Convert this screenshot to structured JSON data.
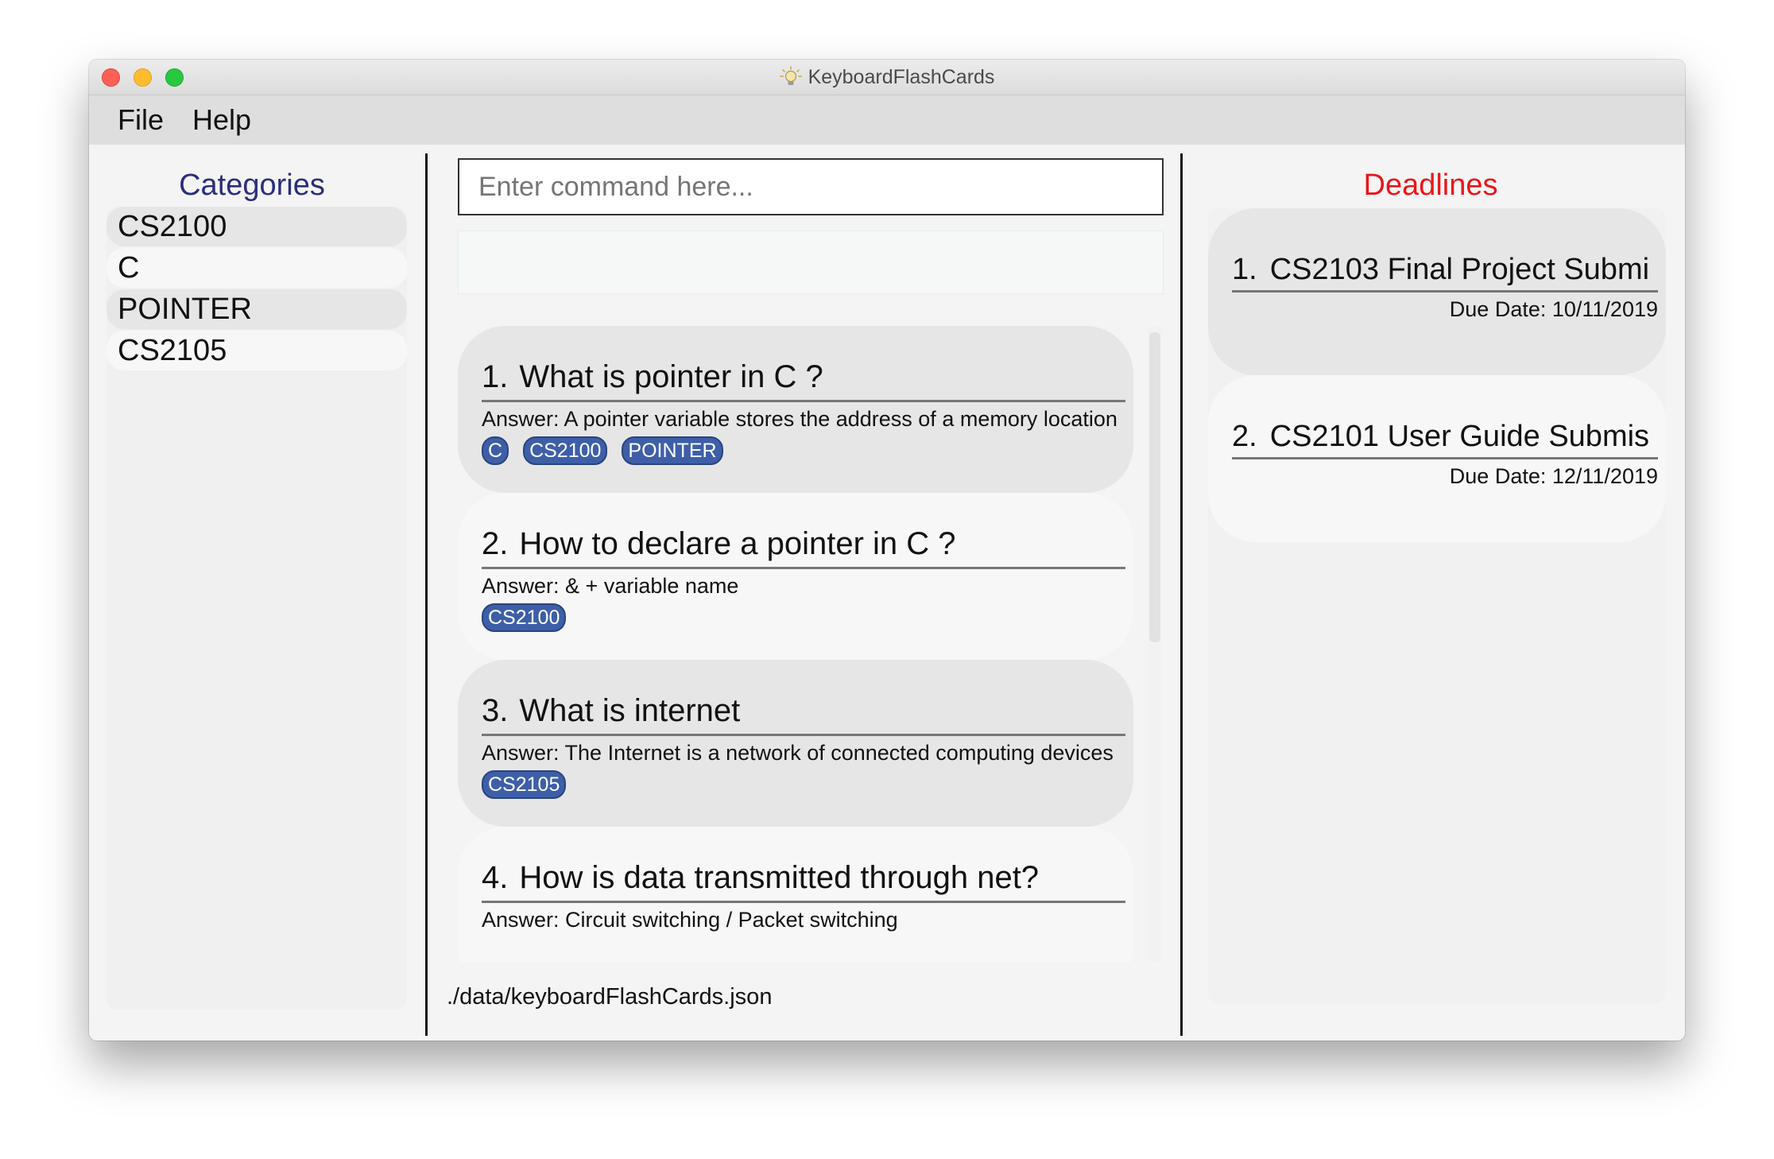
{
  "window": {
    "title": "KeyboardFlashCards"
  },
  "menu": {
    "items": [
      "File",
      "Help"
    ]
  },
  "categories": {
    "title": "Categories",
    "items": [
      "CS2100",
      "C",
      "POINTER",
      "CS2105"
    ]
  },
  "command": {
    "placeholder": "Enter command here...",
    "value": ""
  },
  "result": {
    "text": ""
  },
  "flashcards": [
    {
      "number": "1.",
      "question": "What is pointer in C ?",
      "answer": "Answer: A pointer variable stores the address of a memory location",
      "tags": [
        "C",
        "CS2100",
        "POINTER"
      ]
    },
    {
      "number": "2.",
      "question": "How to declare a pointer in C ?",
      "answer": "Answer: & + variable name",
      "tags": [
        "CS2100"
      ]
    },
    {
      "number": "3.",
      "question": "What is internet",
      "answer": "Answer: The Internet is a network of connected computing devices",
      "tags": [
        "CS2105"
      ]
    },
    {
      "number": "4.",
      "question": "How is data transmitted through net?",
      "answer": "Answer: Circuit switching / Packet switching",
      "tags": []
    }
  ],
  "status": {
    "path": "./data/keyboardFlashCards.json"
  },
  "deadlines": {
    "title": "Deadlines",
    "items": [
      {
        "number": "1.",
        "task": "CS2103 Final Project Submi",
        "due": "Due Date: 10/11/2019"
      },
      {
        "number": "2.",
        "task": "CS2101 User Guide Submis",
        "due": "Due Date: 12/11/2019"
      }
    ]
  },
  "colors": {
    "categories_title": "#2b2e7a",
    "deadlines_title": "#e8161b",
    "tag_background": "#3e5fa8"
  },
  "icons": {
    "app_icon": "lightbulb-icon"
  }
}
